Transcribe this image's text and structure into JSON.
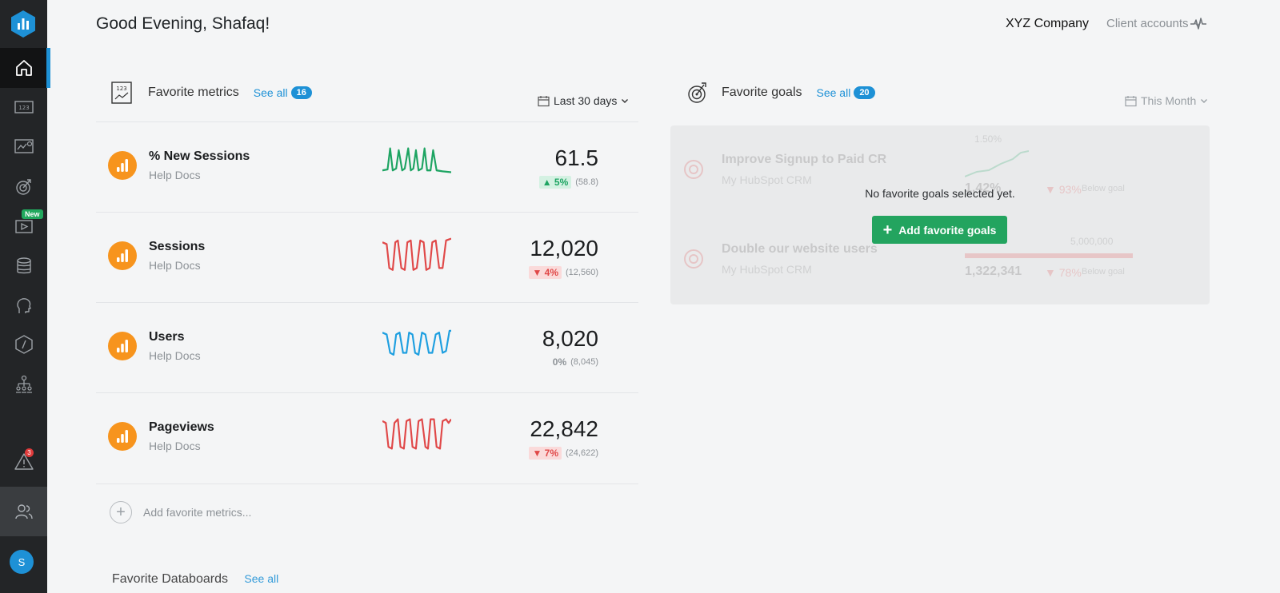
{
  "header": {
    "greeting": "Good Evening, Shafaq!",
    "company": "XYZ Company",
    "client_accounts": "Client accounts"
  },
  "sidebar": {
    "new_badge": "New",
    "alert_count": "3",
    "avatar_initial": "S"
  },
  "metrics_panel": {
    "title": "Favorite metrics",
    "see_all": "See all",
    "count": "16",
    "range": "Last 30 days",
    "add_label": "Add favorite metrics...",
    "items": [
      {
        "name": "% New Sessions",
        "source": "Help Docs",
        "value": "61.5",
        "change": "▲ 5%",
        "prev": "(58.8)",
        "trend": "up",
        "color": "#1da462"
      },
      {
        "name": "Sessions",
        "source": "Help Docs",
        "value": "12,020",
        "change": "▼ 4%",
        "prev": "(12,560)",
        "trend": "down",
        "color": "#e04848"
      },
      {
        "name": "Users",
        "source": "Help Docs",
        "value": "8,020",
        "change": "0%",
        "prev": "(8,045)",
        "trend": "flat",
        "color": "#1e9fe0"
      },
      {
        "name": "Pageviews",
        "source": "Help Docs",
        "value": "22,842",
        "change": "▼ 7%",
        "prev": "(24,622)",
        "trend": "down",
        "color": "#e04848"
      }
    ]
  },
  "goals_panel": {
    "title": "Favorite goals",
    "see_all": "See all",
    "count": "20",
    "range": "This Month",
    "empty_message": "No favorite goals selected yet.",
    "add_button": "Add favorite goals",
    "ghost_goals": [
      {
        "title": "Improve Signup to Paid CR",
        "source": "My HubSpot CRM",
        "target": "1.50%",
        "current": "1.42%",
        "delta": "▼ 93%",
        "status": "Below goal"
      },
      {
        "title": "Double our website users",
        "source": "My HubSpot CRM",
        "target": "5,000,000",
        "current": "1,322,341",
        "delta": "▼ 78%",
        "status": "Below goal"
      }
    ]
  },
  "next_section": {
    "title": "Favorite Databoards",
    "see_all": "See all"
  }
}
